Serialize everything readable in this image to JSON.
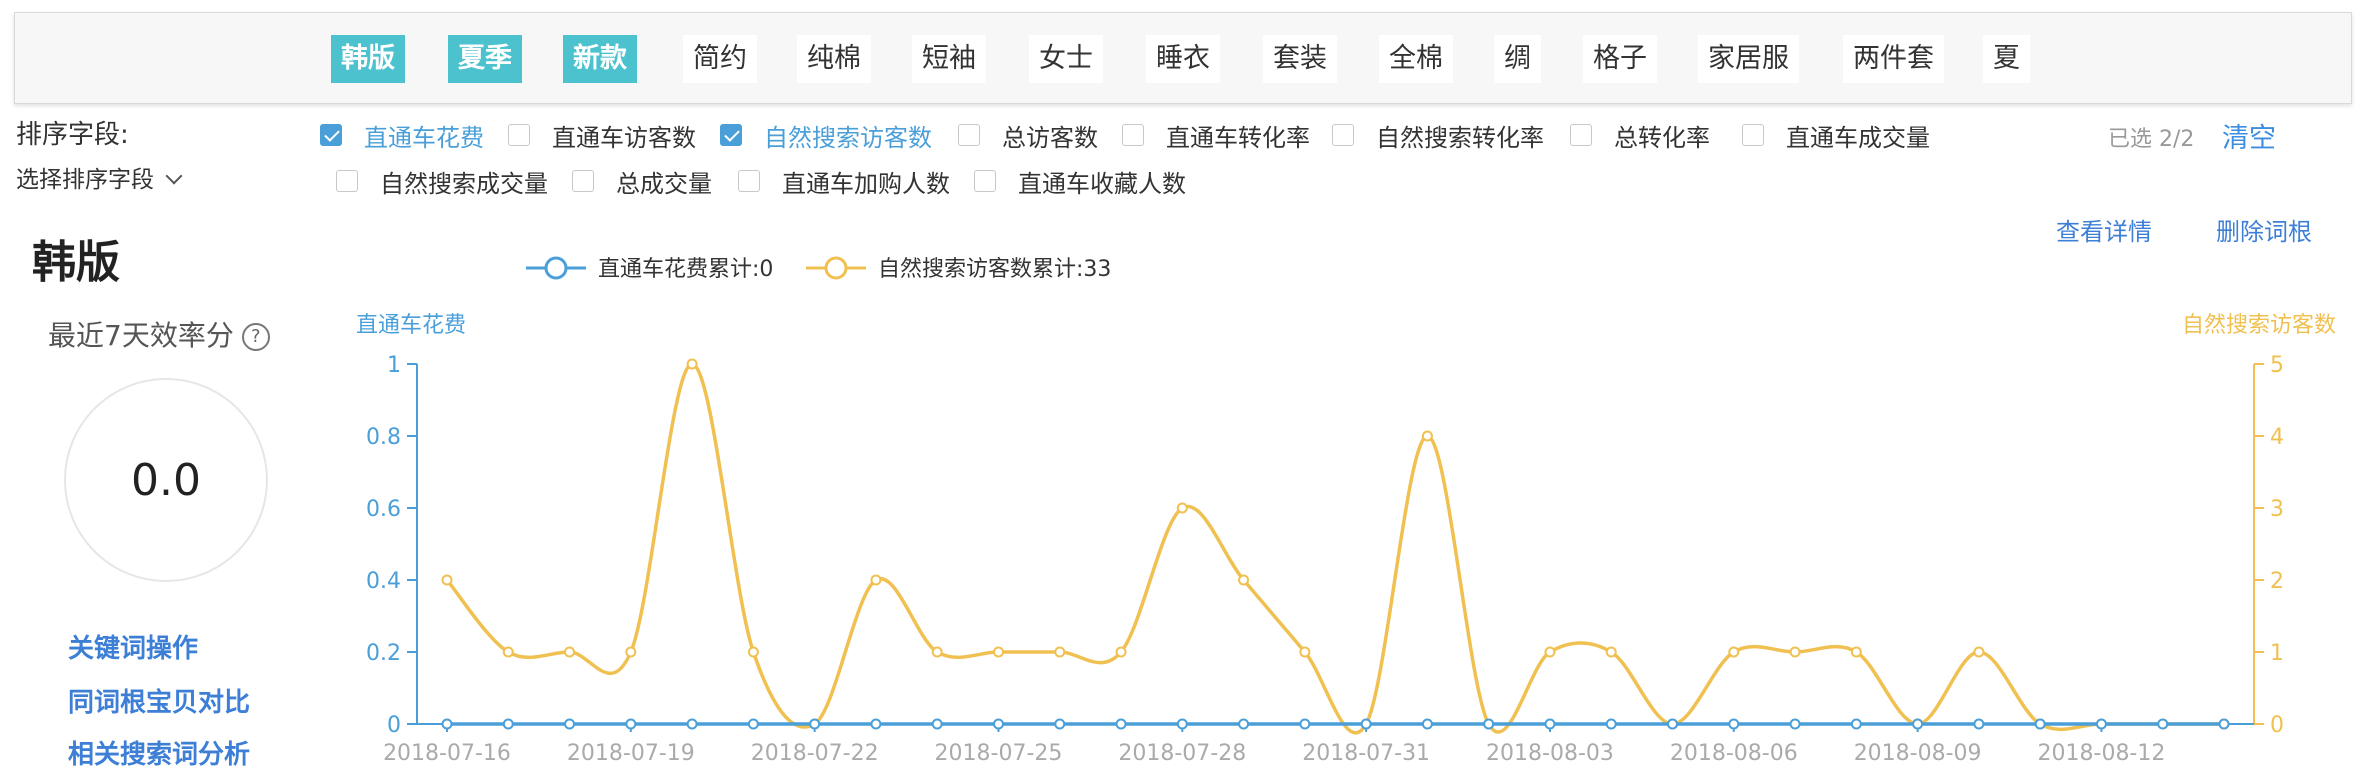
{
  "tags": [
    {
      "label": "韩版",
      "active": true
    },
    {
      "label": "夏季",
      "active": true
    },
    {
      "label": "新款",
      "active": true
    },
    {
      "label": "简约",
      "active": false
    },
    {
      "label": "纯棉",
      "active": false
    },
    {
      "label": "短袖",
      "active": false
    },
    {
      "label": "女士",
      "active": false
    },
    {
      "label": "睡衣",
      "active": false
    },
    {
      "label": "套装",
      "active": false
    },
    {
      "label": "全棉",
      "active": false
    },
    {
      "label": "绸",
      "active": false
    },
    {
      "label": "格子",
      "active": false
    },
    {
      "label": "家居服",
      "active": false
    },
    {
      "label": "两件套",
      "active": false
    },
    {
      "label": "夏",
      "active": false
    }
  ],
  "sort": {
    "label": "排序字段:",
    "select_placeholder": "选择排序字段",
    "fields": [
      {
        "label": "直通车花费",
        "checked": true
      },
      {
        "label": "直通车访客数",
        "checked": false
      },
      {
        "label": "自然搜索访客数",
        "checked": true
      },
      {
        "label": "总访客数",
        "checked": false
      },
      {
        "label": "直通车转化率",
        "checked": false
      },
      {
        "label": "自然搜索转化率",
        "checked": false
      },
      {
        "label": "总转化率",
        "checked": false
      },
      {
        "label": "直通车成交量",
        "checked": false
      },
      {
        "label": "自然搜索成交量",
        "checked": false
      },
      {
        "label": "总成交量",
        "checked": false
      },
      {
        "label": "直通车加购人数",
        "checked": false
      },
      {
        "label": "直通车收藏人数",
        "checked": false
      }
    ],
    "selected_count": "已选 2/2",
    "clear": "清空"
  },
  "panel": {
    "keyword": "韩版",
    "efficiency_label": "最近7天效率分",
    "help": "?",
    "score": "0.0",
    "links": [
      "关键词操作",
      "同词根宝贝对比",
      "相关搜索词分析"
    ]
  },
  "actions": {
    "view_detail": "查看详情",
    "delete_root": "删除词根"
  },
  "colors": {
    "accent": "#4cc2cf",
    "link": "#3d7fd6",
    "series_spend": "#4a9fd9",
    "series_natural": "#f0c050"
  },
  "chart_data": {
    "type": "line",
    "title": "",
    "x": [
      "2018-07-16",
      "2018-07-17",
      "2018-07-18",
      "2018-07-19",
      "2018-07-20",
      "2018-07-21",
      "2018-07-22",
      "2018-07-23",
      "2018-07-24",
      "2018-07-25",
      "2018-07-26",
      "2018-07-27",
      "2018-07-28",
      "2018-07-29",
      "2018-07-30",
      "2018-07-31",
      "2018-08-01",
      "2018-08-02",
      "2018-08-03",
      "2018-08-04",
      "2018-08-05",
      "2018-08-06",
      "2018-08-07",
      "2018-08-08",
      "2018-08-09",
      "2018-08-10",
      "2018-08-11",
      "2018-08-12",
      "2018-08-13",
      "2018-08-14"
    ],
    "x_tick_labels": [
      "2018-07-16",
      "2018-07-19",
      "2018-07-22",
      "2018-07-25",
      "2018-07-28",
      "2018-07-31",
      "2018-08-03",
      "2018-08-06",
      "2018-08-09",
      "2018-08-12"
    ],
    "left_axis": {
      "label": "直通车花费",
      "ylim": [
        0,
        1
      ],
      "ticks": [
        "0",
        "0.2",
        "0.4",
        "0.6",
        "0.8",
        "1"
      ]
    },
    "right_axis": {
      "label": "自然搜索访客数",
      "ylim": [
        0,
        5
      ],
      "ticks": [
        "0",
        "1",
        "2",
        "3",
        "4",
        "5"
      ]
    },
    "legend_placement": "top-center",
    "series": [
      {
        "name": "直通车花费累计:0",
        "axis": "left",
        "color": "#4a9fd9",
        "values": [
          0,
          0,
          0,
          0,
          0,
          0,
          0,
          0,
          0,
          0,
          0,
          0,
          0,
          0,
          0,
          0,
          0,
          0,
          0,
          0,
          0,
          0,
          0,
          0,
          0,
          0,
          0,
          0,
          0,
          0
        ]
      },
      {
        "name": "自然搜索访客数累计:33",
        "axis": "right",
        "color": "#f0c050",
        "values": [
          2,
          1,
          1,
          1,
          5,
          1,
          0,
          2,
          1,
          1,
          1,
          1,
          3,
          2,
          1,
          0,
          4,
          0,
          1,
          1,
          0,
          1,
          1,
          1,
          0,
          1,
          0,
          0,
          0,
          0
        ]
      }
    ]
  }
}
